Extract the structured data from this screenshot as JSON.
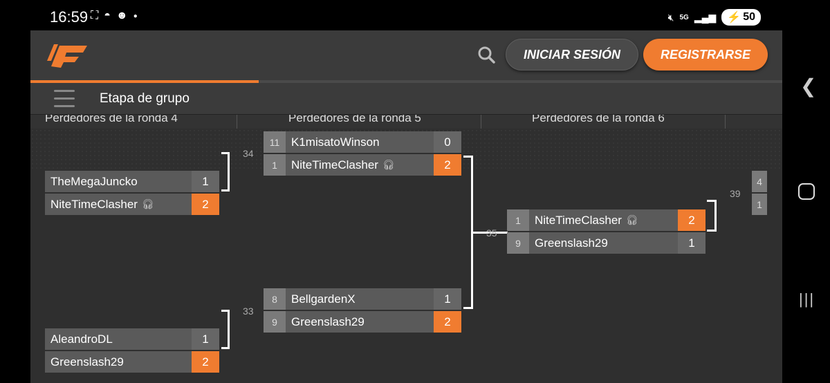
{
  "status": {
    "time": "16:59",
    "battery": "50",
    "network": "5G",
    "icons": [
      "screenshot-icon",
      "pokeball-icon",
      "discord-icon",
      "dot-icon",
      "mute-icon",
      "signal-icon",
      "battery-icon"
    ]
  },
  "header": {
    "login_label": "INICIAR SESIÓN",
    "register_label": "REGISTRARSE"
  },
  "stage": {
    "title": "Etapa de grupo"
  },
  "rounds": [
    {
      "title": "Perdedores de la ronda 4"
    },
    {
      "title": "Perdedores de la ronda 5"
    },
    {
      "title": "Perdedores de la ronda 6"
    }
  ],
  "matches": {
    "m34": {
      "number": "34"
    },
    "m33": {
      "number": "33"
    },
    "m35": {
      "number": "35"
    },
    "m39": {
      "number": "39"
    },
    "r4_top": [
      {
        "name": "TheMegaJuncko",
        "score": "1",
        "win": false,
        "headphones": false
      },
      {
        "name": "NiteTimeClasher",
        "score": "2",
        "win": true,
        "headphones": true
      }
    ],
    "r4_bottom": [
      {
        "name": "AleandroDL",
        "score": "1",
        "win": false,
        "headphones": false
      },
      {
        "name": "Greenslash29",
        "score": "2",
        "win": true,
        "headphones": false
      }
    ],
    "r5_top": [
      {
        "seed": "11",
        "name": "K1misatoWinson",
        "score": "0",
        "win": false,
        "headphones": false
      },
      {
        "seed": "1",
        "name": "NiteTimeClasher",
        "score": "2",
        "win": true,
        "headphones": true
      }
    ],
    "r5_bottom": [
      {
        "seed": "8",
        "name": "BellgardenX",
        "score": "1",
        "win": false,
        "headphones": false
      },
      {
        "seed": "9",
        "name": "Greenslash29",
        "score": "2",
        "win": true,
        "headphones": false
      }
    ],
    "r6": [
      {
        "seed": "1",
        "name": "NiteTimeClasher",
        "score": "2",
        "win": true,
        "headphones": true
      },
      {
        "seed": "9",
        "name": "Greenslash29",
        "score": "1",
        "win": false,
        "headphones": false
      }
    ],
    "r7_partial": [
      {
        "seed": "4"
      },
      {
        "seed": "1"
      }
    ]
  },
  "colors": {
    "accent": "#f07c30",
    "background": "#2f2f2f",
    "topbar": "#3b3b3b"
  }
}
